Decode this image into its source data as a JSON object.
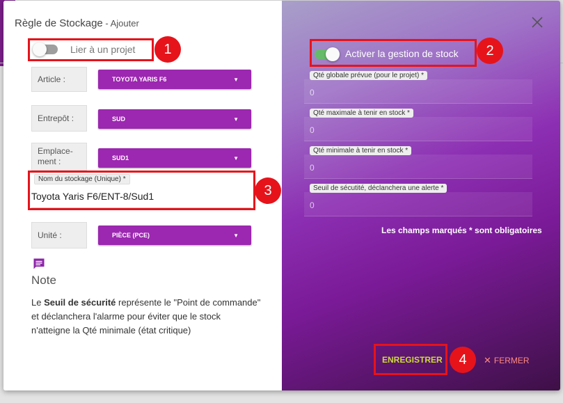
{
  "dialog": {
    "title": "Règle de Stockage",
    "title_separator": " - ",
    "subtitle": "Ajouter"
  },
  "left": {
    "link_project": {
      "label": "Lier à un projet",
      "on": false
    },
    "article": {
      "label": "Article :",
      "value": "TOYOTA YARIS F6"
    },
    "entrepot": {
      "label": "Entrepôt :",
      "value": "SUD"
    },
    "emplacement": {
      "label_line1": "Emplace-",
      "label_line2": "ment :",
      "value": "SUD1"
    },
    "storage_name": {
      "label": "Nom du stockage (Unique) *",
      "value": "Toyota Yaris F6/ENT-8/Sud1"
    },
    "unite": {
      "label": "Unité :",
      "value": "PIÈCE (PCE)"
    },
    "note": {
      "icon": "comment-icon",
      "title": "Note",
      "text_prefix": "Le ",
      "text_bold": "Seuil de sécurité",
      "text_suffix": " représente le \"Point de commande\" et déclanchera l'alarme pour éviter que le stock n'atteigne la Qté minimale (état critique)"
    }
  },
  "right": {
    "stock_management": {
      "label": "Activer la gestion de stock",
      "on": true
    },
    "fields": [
      {
        "label": "Qté globale prévue (pour le projet) *",
        "value": "0"
      },
      {
        "label": "Qté maximale à tenir en stock *",
        "value": "0"
      },
      {
        "label": "Qté minimale à tenir en stock *",
        "value": "0"
      },
      {
        "label": "Seuil de sécutité, déclanchera une alerte *",
        "value": "0"
      }
    ],
    "mandatory_note": "Les champs marqués * sont obligatoires",
    "save_label": "ENREGISTRER",
    "close_label": "FERMER",
    "close_icon": "close-icon"
  },
  "callouts": [
    "1",
    "2",
    "3",
    "4"
  ],
  "colors": {
    "accent_purple": "#9c27b0",
    "callout_red": "#e6131b",
    "toggle_on": "#66bb6a",
    "save_text": "#cddc39",
    "close_text": "#ff8a80"
  }
}
